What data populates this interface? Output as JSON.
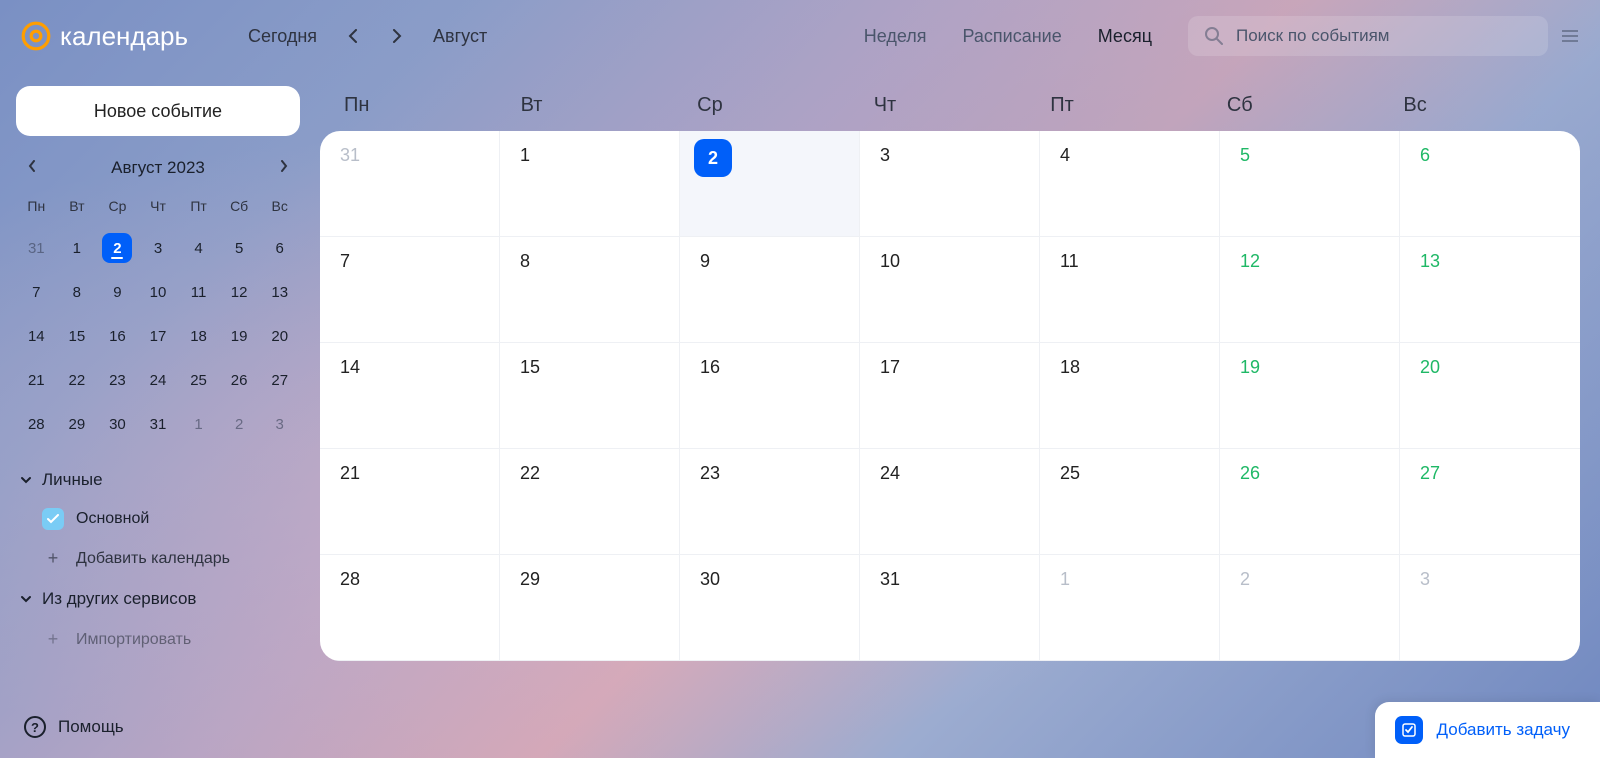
{
  "brand": "календарь",
  "header": {
    "today": "Сегодня",
    "month": "Август",
    "tabs": [
      "Неделя",
      "Расписание",
      "Месяц"
    ],
    "active_tab": 2,
    "search_placeholder": "Поиск по событиям"
  },
  "sidebar": {
    "new_event": "Новое событие",
    "mini_title": "Август 2023",
    "mini_headers": [
      "Пн",
      "Вт",
      "Ср",
      "Чт",
      "Пт",
      "Сб",
      "Вс"
    ],
    "mini_weeks": [
      [
        {
          "n": "31",
          "other": true
        },
        {
          "n": "1"
        },
        {
          "n": "2",
          "today": true
        },
        {
          "n": "3"
        },
        {
          "n": "4"
        },
        {
          "n": "5"
        },
        {
          "n": "6"
        }
      ],
      [
        {
          "n": "7"
        },
        {
          "n": "8"
        },
        {
          "n": "9"
        },
        {
          "n": "10"
        },
        {
          "n": "11"
        },
        {
          "n": "12"
        },
        {
          "n": "13"
        }
      ],
      [
        {
          "n": "14"
        },
        {
          "n": "15"
        },
        {
          "n": "16"
        },
        {
          "n": "17"
        },
        {
          "n": "18"
        },
        {
          "n": "19"
        },
        {
          "n": "20"
        }
      ],
      [
        {
          "n": "21"
        },
        {
          "n": "22"
        },
        {
          "n": "23"
        },
        {
          "n": "24"
        },
        {
          "n": "25"
        },
        {
          "n": "26"
        },
        {
          "n": "27"
        }
      ],
      [
        {
          "n": "28"
        },
        {
          "n": "29"
        },
        {
          "n": "30"
        },
        {
          "n": "31"
        },
        {
          "n": "1",
          "other": true
        },
        {
          "n": "2",
          "other": true
        },
        {
          "n": "3",
          "other": true
        }
      ]
    ],
    "sections": {
      "personal": "Личные",
      "calendars": [
        {
          "name": "Основной",
          "color": "#7accf5"
        }
      ],
      "add_calendar": "Добавить календарь",
      "other_services": "Из других сервисов",
      "import": "Импортировать"
    },
    "help": "Помощь"
  },
  "main": {
    "headers": [
      "Пн",
      "Вт",
      "Ср",
      "Чт",
      "Пт",
      "Сб",
      "Вс"
    ],
    "weeks": [
      [
        {
          "n": "31",
          "other": true
        },
        {
          "n": "1"
        },
        {
          "n": "2",
          "today": true
        },
        {
          "n": "3"
        },
        {
          "n": "4"
        },
        {
          "n": "5",
          "weekend": true
        },
        {
          "n": "6",
          "weekend": true
        }
      ],
      [
        {
          "n": "7"
        },
        {
          "n": "8"
        },
        {
          "n": "9"
        },
        {
          "n": "10"
        },
        {
          "n": "11"
        },
        {
          "n": "12",
          "weekend": true
        },
        {
          "n": "13",
          "weekend": true
        }
      ],
      [
        {
          "n": "14"
        },
        {
          "n": "15"
        },
        {
          "n": "16"
        },
        {
          "n": "17"
        },
        {
          "n": "18"
        },
        {
          "n": "19",
          "weekend": true
        },
        {
          "n": "20",
          "weekend": true
        }
      ],
      [
        {
          "n": "21"
        },
        {
          "n": "22"
        },
        {
          "n": "23"
        },
        {
          "n": "24"
        },
        {
          "n": "25"
        },
        {
          "n": "26",
          "weekend": true
        },
        {
          "n": "27",
          "weekend": true
        }
      ],
      [
        {
          "n": "28"
        },
        {
          "n": "29"
        },
        {
          "n": "30"
        },
        {
          "n": "31"
        },
        {
          "n": "1",
          "other": true
        },
        {
          "n": "2",
          "other": true
        },
        {
          "n": "3",
          "other": true
        }
      ]
    ]
  },
  "add_task": "Добавить задачу"
}
